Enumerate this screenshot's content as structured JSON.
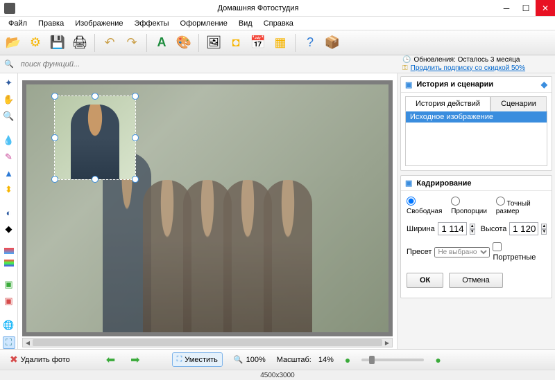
{
  "window": {
    "title": "Домашняя Фотостудия"
  },
  "menu": [
    "Файл",
    "Правка",
    "Изображение",
    "Эффекты",
    "Оформление",
    "Вид",
    "Справка"
  ],
  "toolbar_icons": [
    "folder-open",
    "gear",
    "save",
    "print",
    "",
    "undo",
    "redo",
    "",
    "text-a",
    "palette",
    "",
    "picture",
    "frame",
    "calendar",
    "batch",
    "",
    "help",
    "box3d"
  ],
  "search": {
    "placeholder": "поиск функций..."
  },
  "update": {
    "label": "Обновления: Осталось  3 месяца",
    "link": "Продлить подписку со скидкой 50%"
  },
  "left_tools": [
    "pointer",
    "hand",
    "zoom",
    "",
    "eyedrop",
    "brush",
    "stamp",
    "levels",
    "",
    "contrast",
    "crop2",
    "",
    "gradient",
    "rgb",
    "",
    "layers",
    "clone",
    "",
    "globe",
    "crop"
  ],
  "history_panel": {
    "title": "История и сценарии",
    "tabs": [
      "История действий",
      "Сценарии"
    ],
    "items": [
      "Исходное изображение"
    ]
  },
  "crop_panel": {
    "title": "Кадрирование",
    "modes": [
      "Свободная",
      "Пропорции",
      "Точный размер"
    ],
    "width_label": "Ширина",
    "width_value": "1 114",
    "height_label": "Высота",
    "height_value": "1 120",
    "preset_label": "Пресет",
    "preset_value": "Не выбрано",
    "portrait_label": "Портретные",
    "ok": "ОК",
    "cancel": "Отмена"
  },
  "bottom": {
    "delete": "Удалить фото",
    "fit": "Уместить",
    "zoom100": "100%",
    "scale_label": "Масштаб:",
    "scale_value": "14%"
  },
  "status": {
    "dimensions": "4500x3000"
  }
}
